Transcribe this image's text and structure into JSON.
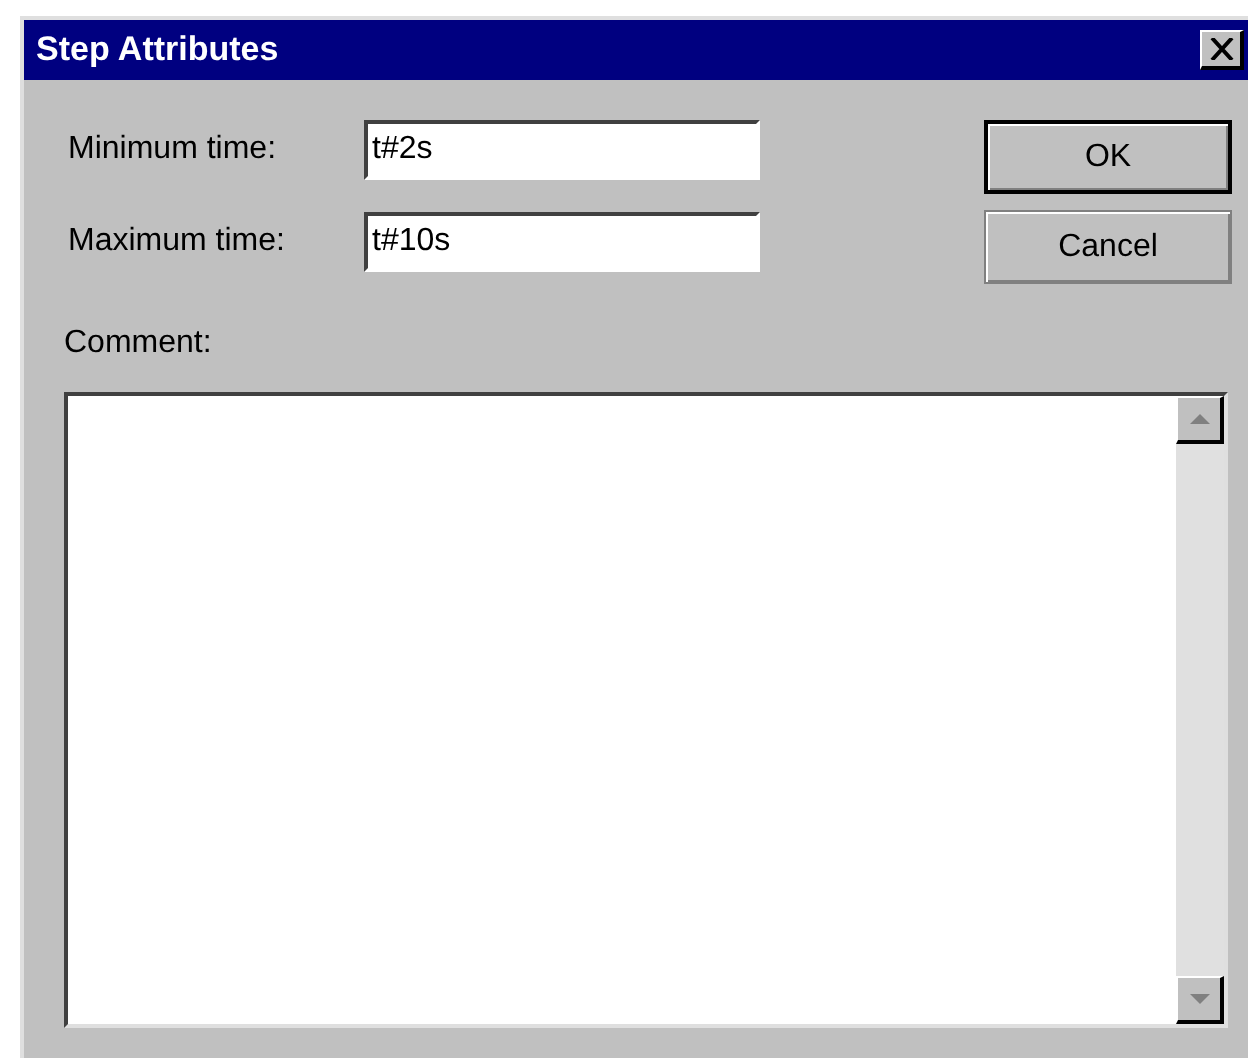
{
  "window": {
    "title": "Step Attributes"
  },
  "fields": [
    {
      "label": "Minimum time:",
      "value": "t#2s"
    },
    {
      "label": "Maximum time:",
      "value": "t#10s"
    }
  ],
  "buttons": [
    {
      "label": "OK",
      "default": true
    },
    {
      "label": "Cancel",
      "default": false
    }
  ],
  "comment": {
    "label": "Comment:"
  }
}
